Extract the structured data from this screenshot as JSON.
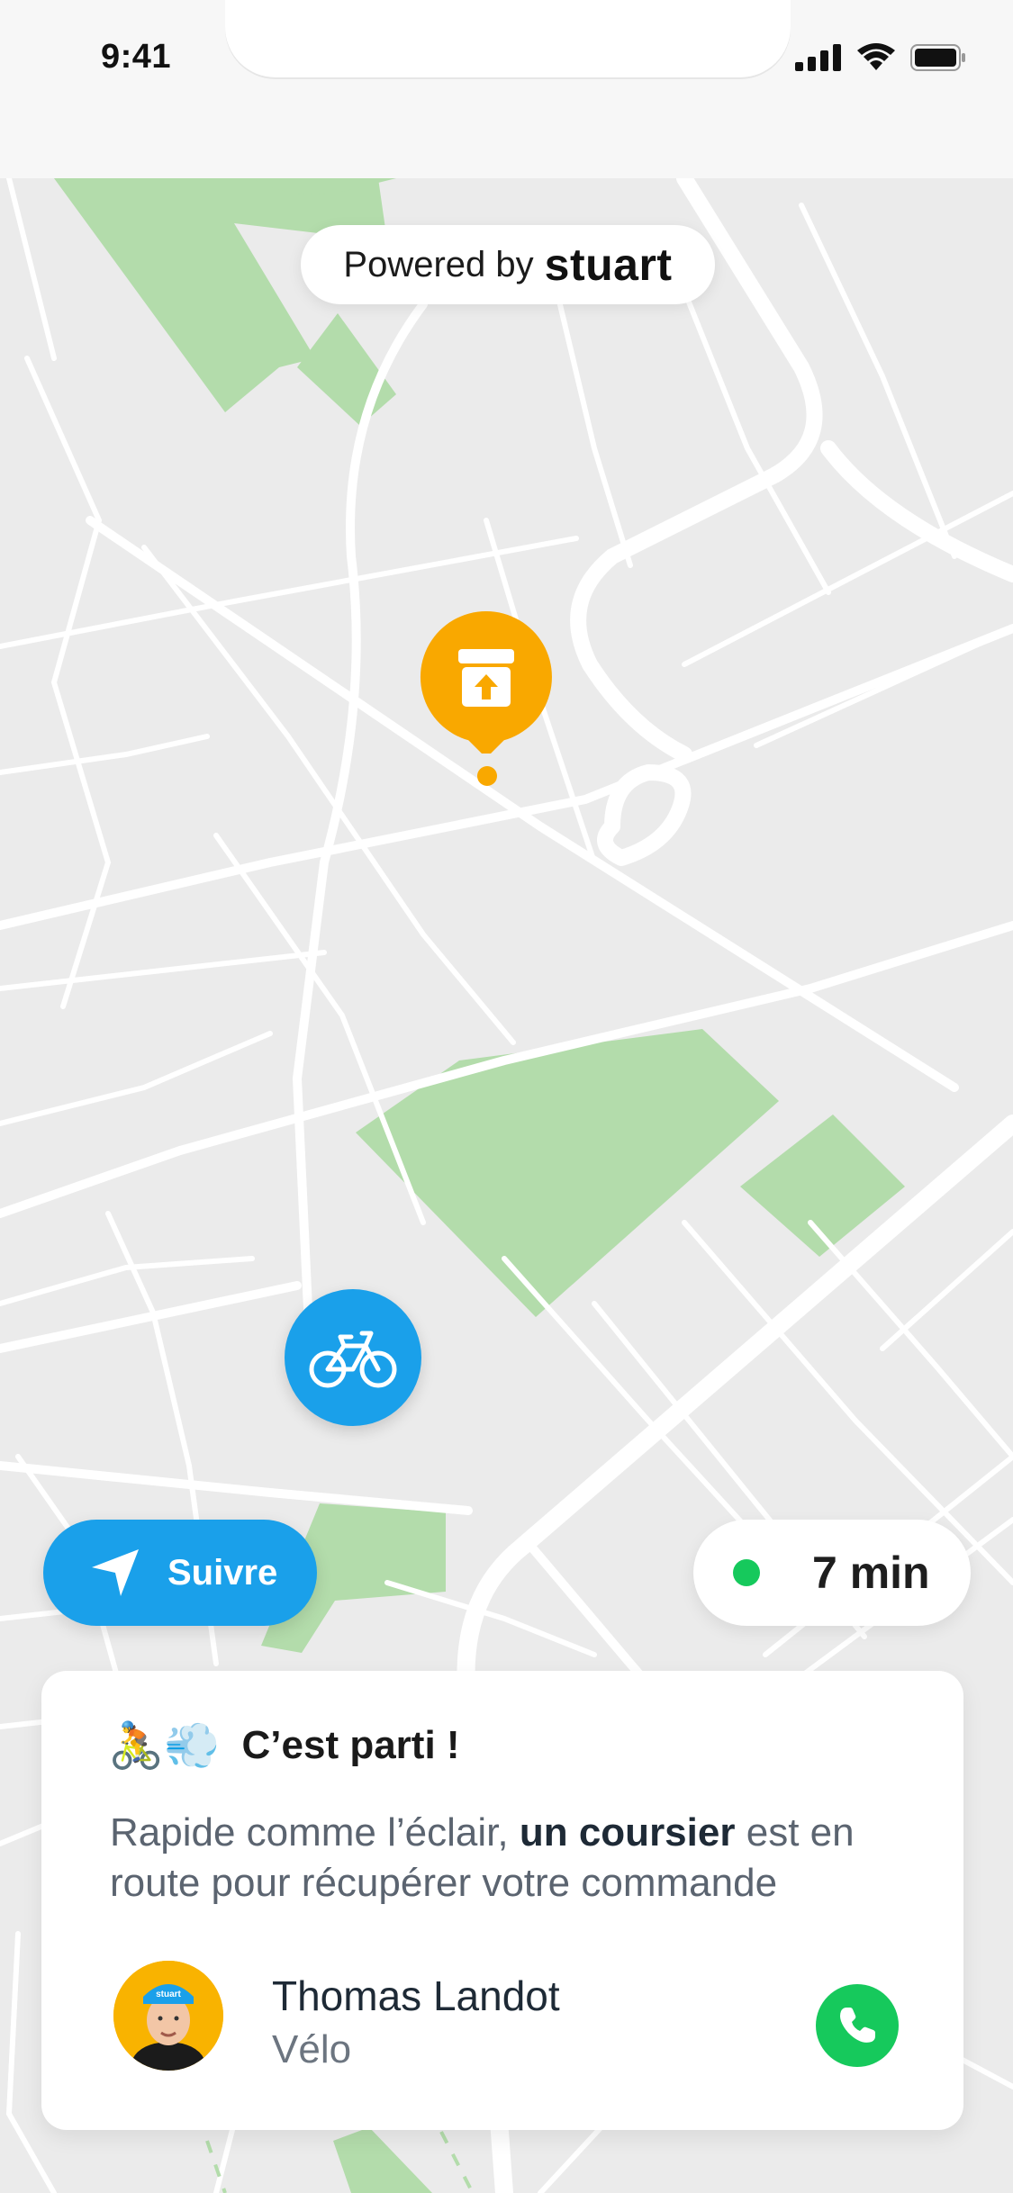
{
  "status_bar": {
    "time": "9:41"
  },
  "map": {
    "powered_prefix": "Powered by",
    "powered_brand": "stuart",
    "colors": {
      "background": "#ebebeb",
      "roads": "#ffffff",
      "parks": "#b3dcab",
      "pin": "#f9a800",
      "courier": "#1aa0ea"
    }
  },
  "actions": {
    "follow_label": "Suivre"
  },
  "eta": {
    "value": "7 min",
    "status_color": "#16c95c"
  },
  "card": {
    "emoji": "🚴💨",
    "title": "C’est parti !",
    "message_before": "Rapide comme l’éclair,",
    "message_bold": "un coursier",
    "message_after": "est en route pour récupérer votre commande",
    "driver": {
      "name": "Thomas Landot",
      "mode": "Vélo",
      "helmet_text": "stuart"
    }
  },
  "icons": [
    "signal-icon",
    "wifi-icon",
    "battery-icon",
    "package-pickup-icon",
    "bicycle-icon",
    "navigation-arrow-icon",
    "phone-icon"
  ]
}
